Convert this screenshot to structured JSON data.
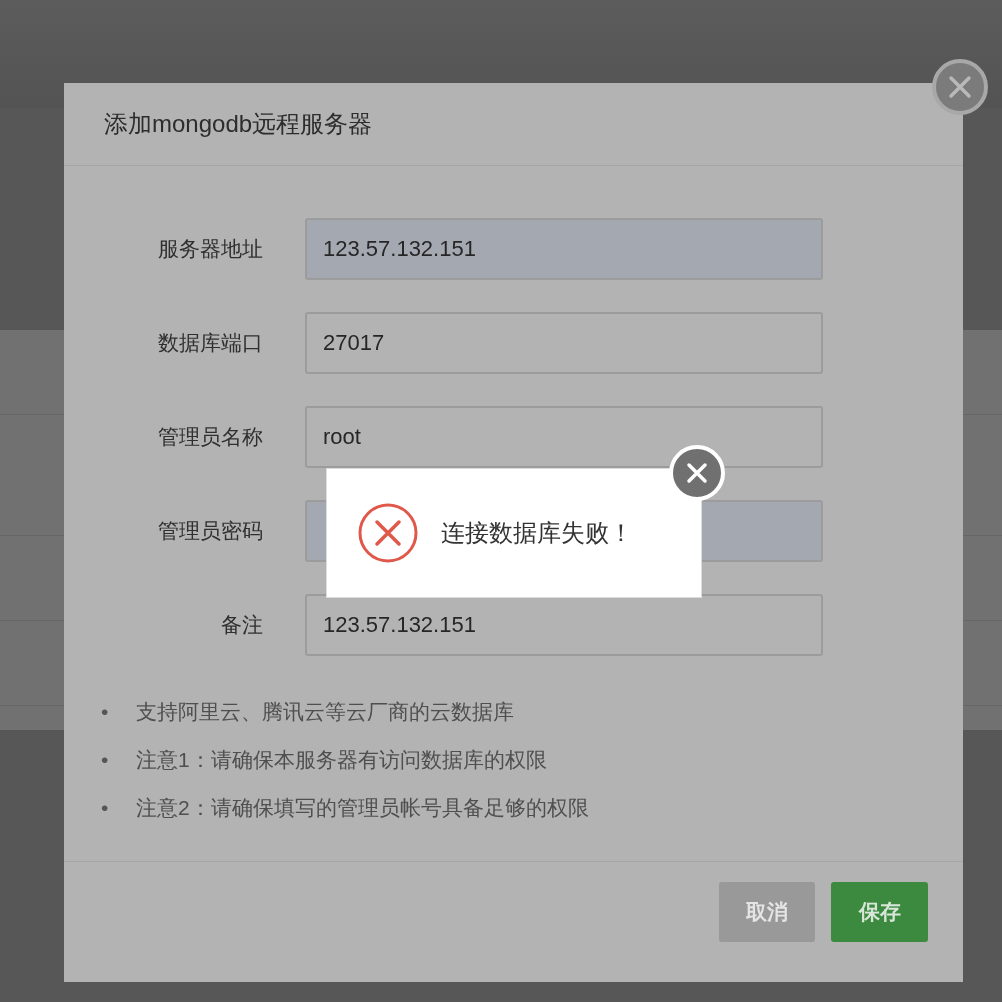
{
  "dialog": {
    "title": "添加mongodb远程服务器",
    "fields": [
      {
        "label": "服务器地址",
        "value": "123.57.132.151",
        "autofilled": true
      },
      {
        "label": "数据库端口",
        "value": "27017",
        "autofilled": false
      },
      {
        "label": "管理员名称",
        "value": "root",
        "autofilled": false
      },
      {
        "label": "管理员密码",
        "autofilled": true
      },
      {
        "label": "备注",
        "value": "123.57.132.151",
        "autofilled": false
      }
    ],
    "notes": [
      {
        "marker": "•",
        "text": "支持阿里云、腾讯云等云厂商的云数据库"
      },
      {
        "marker": "•",
        "text": "注意1：请确保本服务器有访问数据库的权限"
      },
      {
        "marker": "•",
        "text": "注意2：请确保填写的管理员帐号具备足够的权限"
      }
    ],
    "buttons": [
      {
        "label": "取消",
        "kind": "secondary"
      },
      {
        "label": "保存",
        "kind": "primary"
      }
    ]
  },
  "toast": {
    "message": "连接数据库失败！"
  }
}
